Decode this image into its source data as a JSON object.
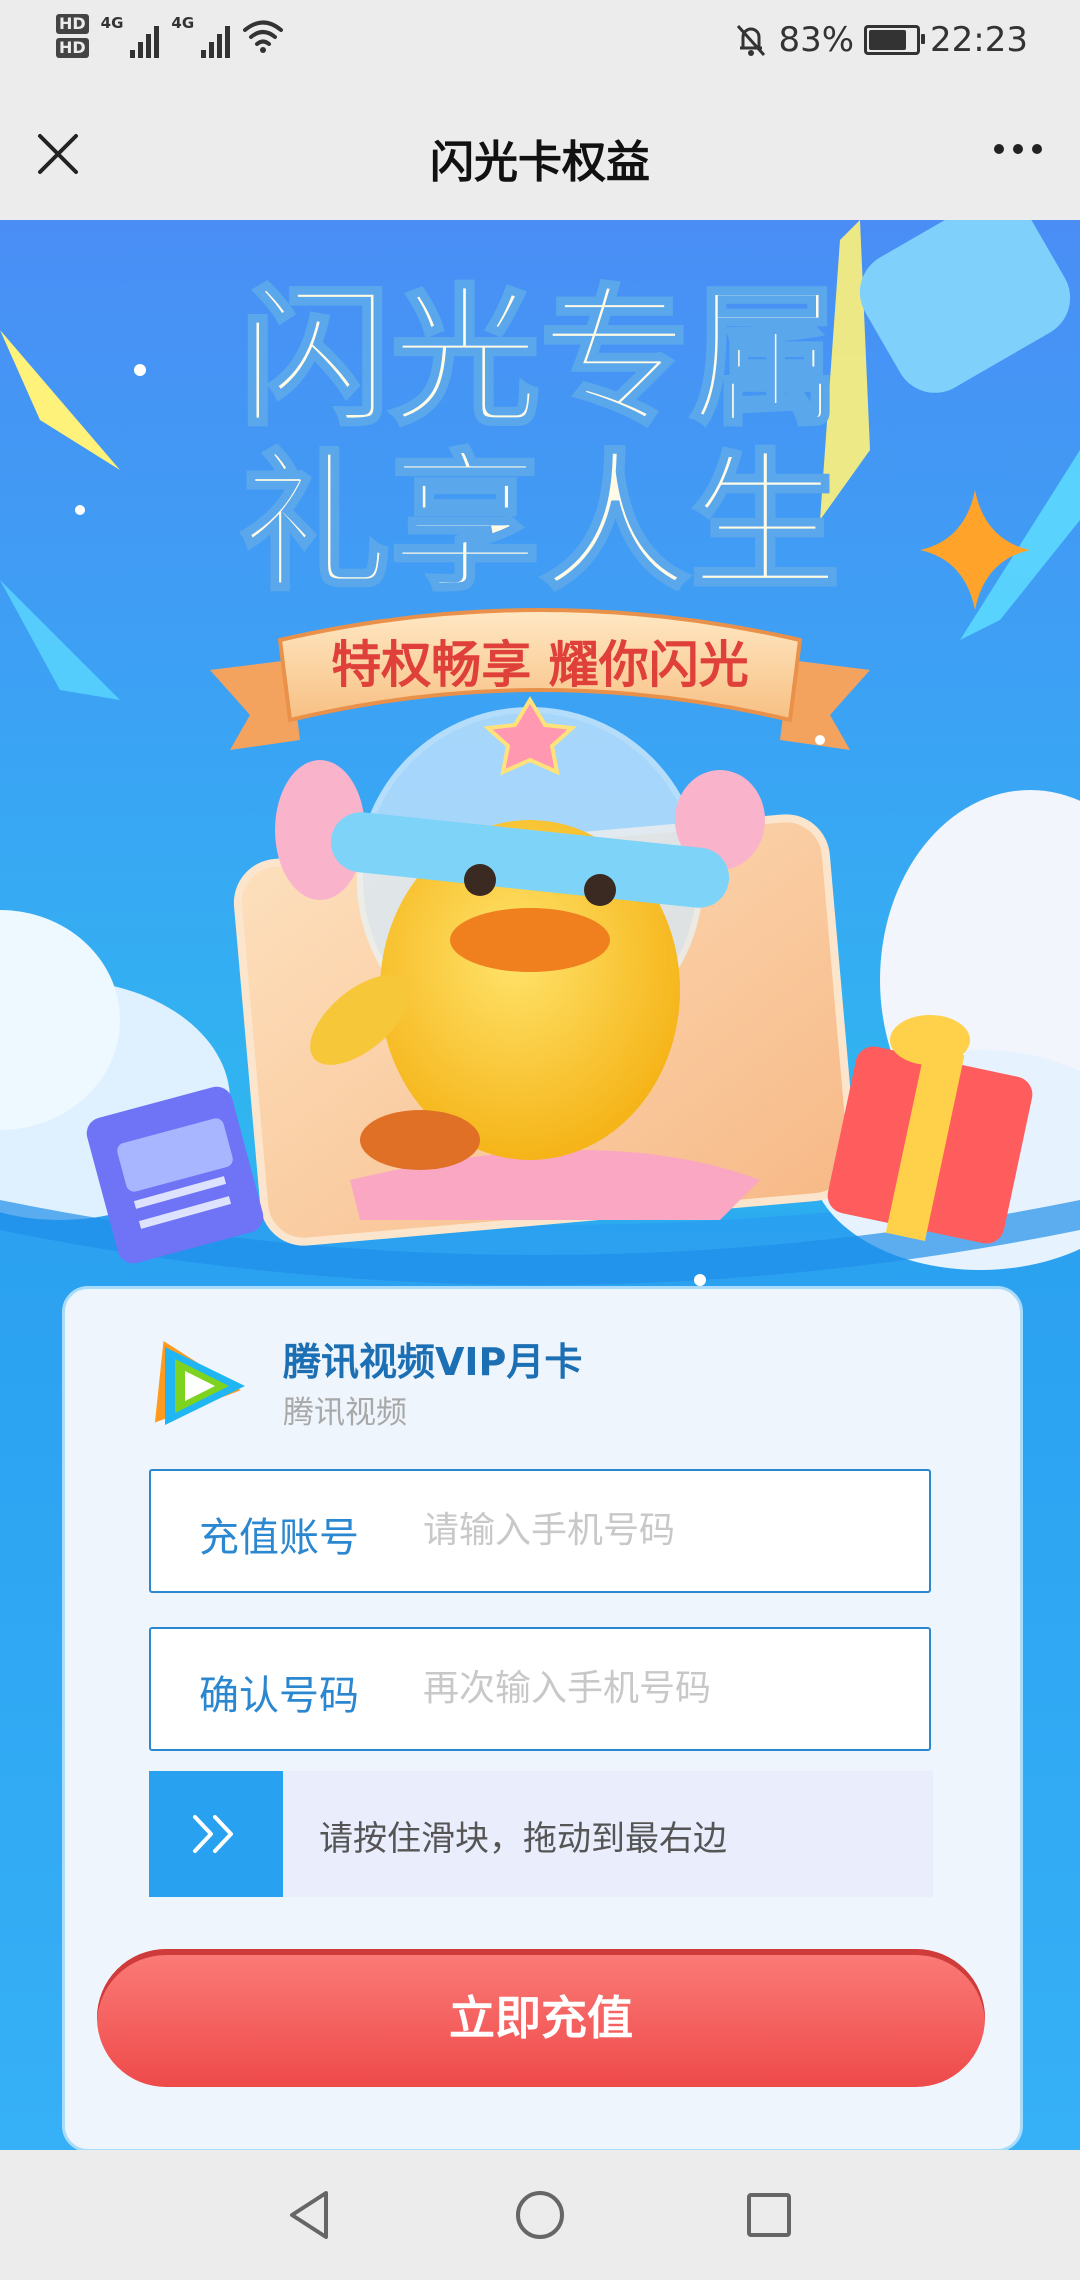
{
  "status_bar": {
    "hd1": "HD",
    "hd2": "HD",
    "net1": "4G",
    "net2": "4G",
    "battery_pct": "83%",
    "time": "22:23"
  },
  "nav": {
    "title": "闪光卡权益"
  },
  "banner": {
    "headline_line1": "闪光专属",
    "headline_line2": "礼享人生",
    "ribbon": "特权畅享 耀你闪光"
  },
  "card": {
    "product_title": "腾讯视频VIP月卡",
    "product_sub": "腾讯视频",
    "account_label": "充值账号",
    "account_placeholder": "请输入手机号码",
    "confirm_label": "确认号码",
    "confirm_placeholder": "再次输入手机号码",
    "slider_text": "请按住滑块，拖动到最右边",
    "submit_label": "立即充值"
  },
  "colors": {
    "primary_blue": "#2b87cf",
    "submit_red": "#ee4a4a",
    "hero_blue": "#39a6f4"
  }
}
